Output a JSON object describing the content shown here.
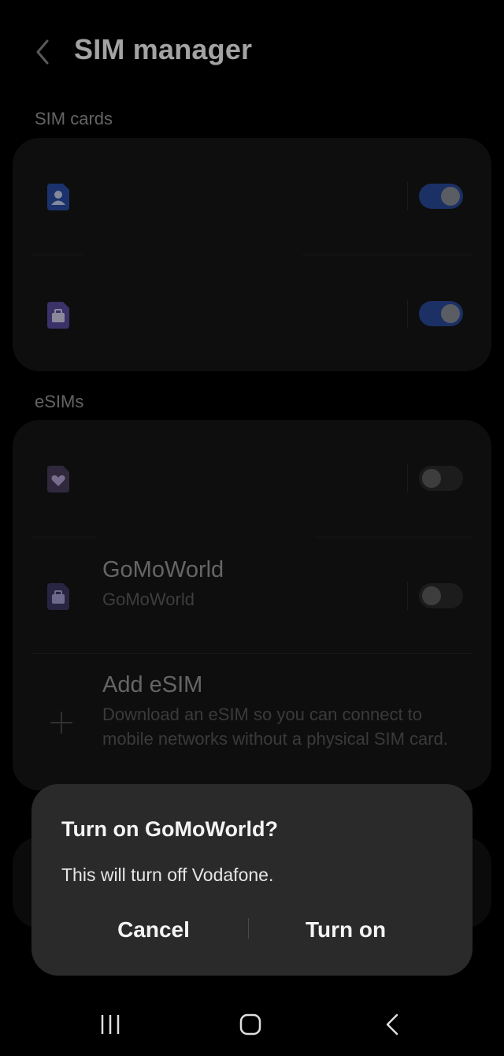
{
  "header": {
    "title": "SIM manager"
  },
  "sections": {
    "sim_cards": "SIM cards",
    "esims": "eSIMs"
  },
  "sim_cards": [
    {
      "icon": "sim-person-icon",
      "enabled": true,
      "color": "#2a4ea8"
    },
    {
      "icon": "sim-briefcase-icon",
      "enabled": true,
      "color": "#5a4ea0"
    }
  ],
  "esims": [
    {
      "icon": "sim-heart-icon",
      "name": "",
      "subtitle": "",
      "enabled": false
    },
    {
      "icon": "sim-briefcase-icon",
      "name": "GoMoWorld",
      "subtitle": "GoMoWorld",
      "enabled": false
    }
  ],
  "add_esim": {
    "title": "Add eSIM",
    "description": "Download an eSIM so you can connect to mobile networks without a physical SIM card."
  },
  "dialog": {
    "title": "Turn on GoMoWorld?",
    "message": "This will turn off Vodafone.",
    "cancel_label": "Cancel",
    "confirm_label": "Turn on"
  },
  "navbar": {
    "recents": "recents-icon",
    "home": "home-icon",
    "back": "back-icon"
  },
  "colors": {
    "toggle_on": "#2a4a9c",
    "dialog_bg": "#2a2a2a",
    "card_bg": "#161616"
  }
}
